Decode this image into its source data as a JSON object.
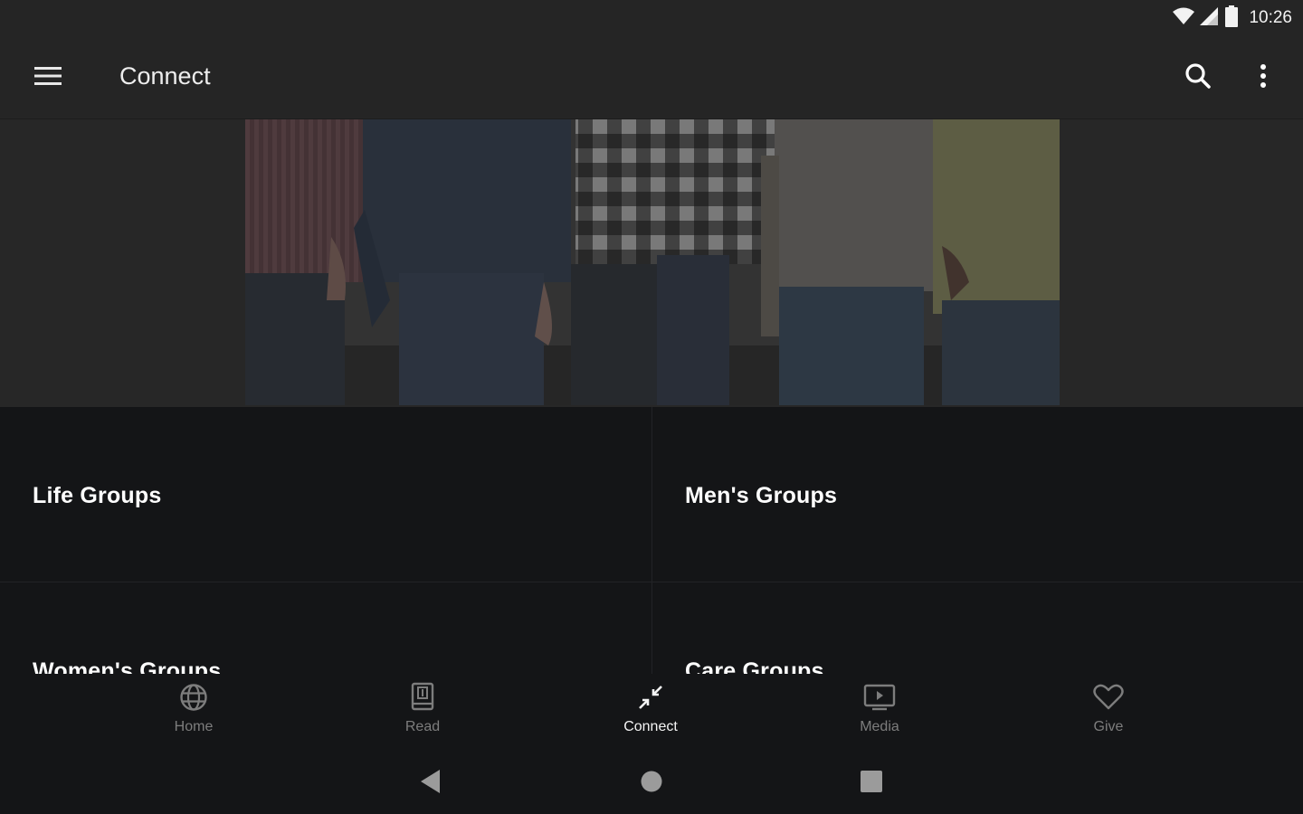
{
  "status_bar": {
    "time": "10:26"
  },
  "app_bar": {
    "title": "Connect"
  },
  "hero": {
    "image_alt": "Group of people standing together"
  },
  "groups": [
    {
      "label": "Life Groups"
    },
    {
      "label": "Men's Groups"
    },
    {
      "label": "Women's Groups"
    },
    {
      "label": "Care Groups"
    }
  ],
  "bottom_nav": {
    "items": [
      {
        "label": "Home",
        "icon": "globe-icon",
        "active": false
      },
      {
        "label": "Read",
        "icon": "book-icon",
        "active": false
      },
      {
        "label": "Connect",
        "icon": "connect-arrows-icon",
        "active": true
      },
      {
        "label": "Media",
        "icon": "tv-play-icon",
        "active": false
      },
      {
        "label": "Give",
        "icon": "heart-icon",
        "active": false
      }
    ]
  },
  "system_nav": {
    "back": "back-icon",
    "home": "home-icon",
    "recents": "recents-icon"
  },
  "colors": {
    "background": "#141517",
    "app_bar": "#252525",
    "active_text": "#f4f4f4",
    "inactive_text": "#7d7d7d"
  }
}
